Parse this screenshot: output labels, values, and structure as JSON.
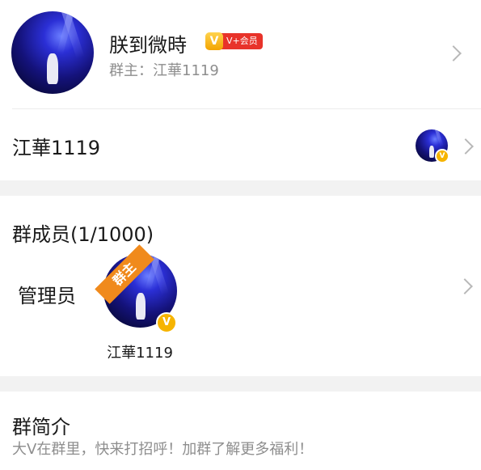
{
  "group": {
    "name": "朕到微時",
    "vip_badge_letter": "V",
    "vip_badge_label": "V+会员",
    "owner_line": "群主：江華1119"
  },
  "owner_row": {
    "name": "江華1119",
    "verified_letter": "V"
  },
  "members": {
    "title": "群成员(1/1000)",
    "admin_label": "管理员",
    "owner_ribbon": "群主",
    "admin_name": "江華1119",
    "verified_letter": "V"
  },
  "intro": {
    "title": "群简介",
    "text": "大V在群里，快来打招呼！加群了解更多福利！"
  },
  "colors": {
    "accent_orange": "#f08a1c",
    "badge_red": "#e8332a",
    "badge_gold": "#f6b400",
    "divider": "#f2f2f2"
  }
}
